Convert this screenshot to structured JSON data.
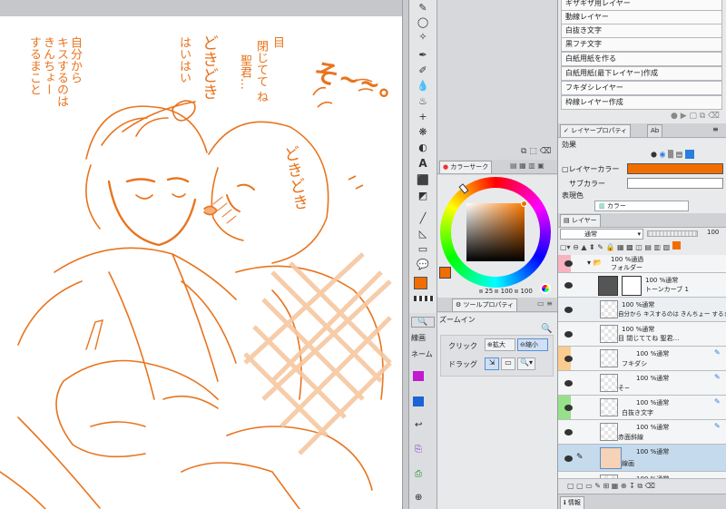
{
  "canvas": {
    "text_left": [
      "自分から",
      "キスするのは",
      "きんちょー",
      "するまこと"
    ],
    "text_right_upper": [
      "目",
      "閉じてて ね",
      "聖君…"
    ],
    "text_hai": "はいはい",
    "text_doki1": "どきどき",
    "text_doki2": "どきどき",
    "text_sowa": "そ~~。"
  },
  "colors": {
    "ink": "#e8741e",
    "main_color": "#f26d00"
  },
  "colorwheel": {
    "tab_label": "カラーサーク",
    "hsv_values": [
      "25",
      "100",
      "100"
    ]
  },
  "tool_property": {
    "tab_label": "ツールプロパティ",
    "title": "ズームイン",
    "click_label": "クリック",
    "zoom_in": "拡大",
    "zoom_out": "縮小",
    "drag_label": "ドラッグ"
  },
  "left_strip": {
    "item1": "線画",
    "item2": "ネーム"
  },
  "material_list": [
    "ギザギザ用レイヤー",
    "動線レイヤー",
    "白抜き文字",
    "黒フチ文字",
    "白紙用紙を作る",
    "白紙用紙(最下レイヤー)作成",
    "フキダシレイヤー",
    "枠線レイヤー作成"
  ],
  "layer_property": {
    "tab_label": "レイヤープロパティ",
    "tab2_label": "Ab",
    "effect_label": "効果",
    "layer_color_label": "レイヤーカラー",
    "sub_color_label": "サブカラー",
    "expression_label": "表現色",
    "expression_value": "カラー"
  },
  "layers_panel": {
    "tab_label": "レイヤー",
    "blend_mode": "通常",
    "opacity": "100",
    "layers": [
      {
        "line1": "100 %通過",
        "line2": "フォルダー",
        "tag": ""
      },
      {
        "line1": "100 %通常",
        "line2": "トーンカーブ 1",
        "tag": ""
      },
      {
        "line1": "100 %通常",
        "line2": "自分から キスするのは きんちょー するまこと",
        "tag": ""
      },
      {
        "line1": "100 %通常",
        "line2": "目 閉じててね 聖君…",
        "tag": ""
      },
      {
        "line1": "100 %通常",
        "line2": "フキダシ",
        "tag": ""
      },
      {
        "line1": "100 %通常",
        "line2": "そ~",
        "tag": ""
      },
      {
        "line1": "100 %通常",
        "line2": "白抜き文字",
        "tag": ""
      },
      {
        "line1": "100 %通常",
        "line2": "赤面斜線",
        "tag": ""
      },
      {
        "line1": "100 %通常",
        "line2": "線画",
        "tag": ""
      },
      {
        "line1": "100 %通常",
        "line2": "",
        "tag": ""
      }
    ]
  },
  "footer": {
    "info_tab": "情報"
  }
}
